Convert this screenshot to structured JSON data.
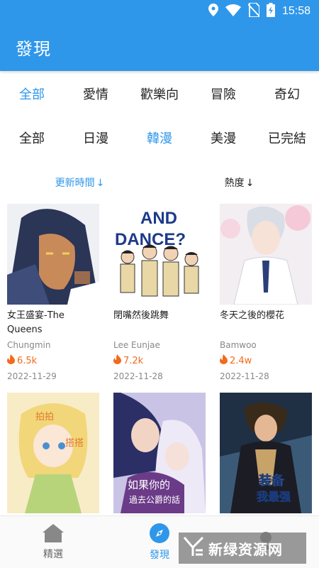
{
  "status_bar": {
    "time": "15:58"
  },
  "app_bar": {
    "title": "發現"
  },
  "filters": {
    "genres": [
      {
        "label": "全部",
        "active": true
      },
      {
        "label": "愛情",
        "active": false
      },
      {
        "label": "歡樂向",
        "active": false
      },
      {
        "label": "冒險",
        "active": false
      },
      {
        "label": "奇幻",
        "active": false
      }
    ],
    "regions": [
      {
        "label": "全部",
        "active": false
      },
      {
        "label": "日漫",
        "active": false
      },
      {
        "label": "韓漫",
        "active": true
      },
      {
        "label": "美漫",
        "active": false
      },
      {
        "label": "已完結",
        "active": false
      }
    ]
  },
  "sort": {
    "update_time": "更新時間",
    "popularity": "熱度",
    "arrow": "↓"
  },
  "comics": [
    {
      "title": "女王盛宴-The Queens",
      "author": "Chungmin",
      "heat": "6.5k",
      "date": "2022-11-29"
    },
    {
      "title": "閉嘴然後跳舞",
      "author": "Lee Eunjae",
      "heat": "7.2k",
      "date": "2022-11-28"
    },
    {
      "title": "冬天之後的櫻花",
      "author": "Bamwoo",
      "heat": "2.4w",
      "date": "2022-11-28"
    },
    {
      "title": "",
      "author": "",
      "heat": "",
      "date": ""
    },
    {
      "title": "",
      "author": "",
      "heat": "",
      "date": ""
    },
    {
      "title": "",
      "author": "",
      "heat": "",
      "date": ""
    }
  ],
  "cover_text": {
    "dance_line1": "AND",
    "dance_line2": "DANCE?",
    "sakura_title": "如果你的",
    "sakura_sub": "過去公爵的話",
    "solo_title": "装备",
    "solo_sub": "我最强",
    "tap1": "拍拍",
    "tap2": "搭搭"
  },
  "bottom_nav": {
    "items": [
      {
        "label": "精選",
        "icon": "home-icon",
        "active": false
      },
      {
        "label": "發現",
        "icon": "compass-icon",
        "active": true
      },
      {
        "label": "",
        "icon": "profile-icon",
        "active": false
      }
    ]
  },
  "watermark": {
    "text": "新绿资源网",
    "url": "xdnsz.com"
  },
  "colors": {
    "primary": "#2f97ea",
    "heat": "#f26a1b",
    "text": "#222222",
    "muted": "#888888"
  }
}
